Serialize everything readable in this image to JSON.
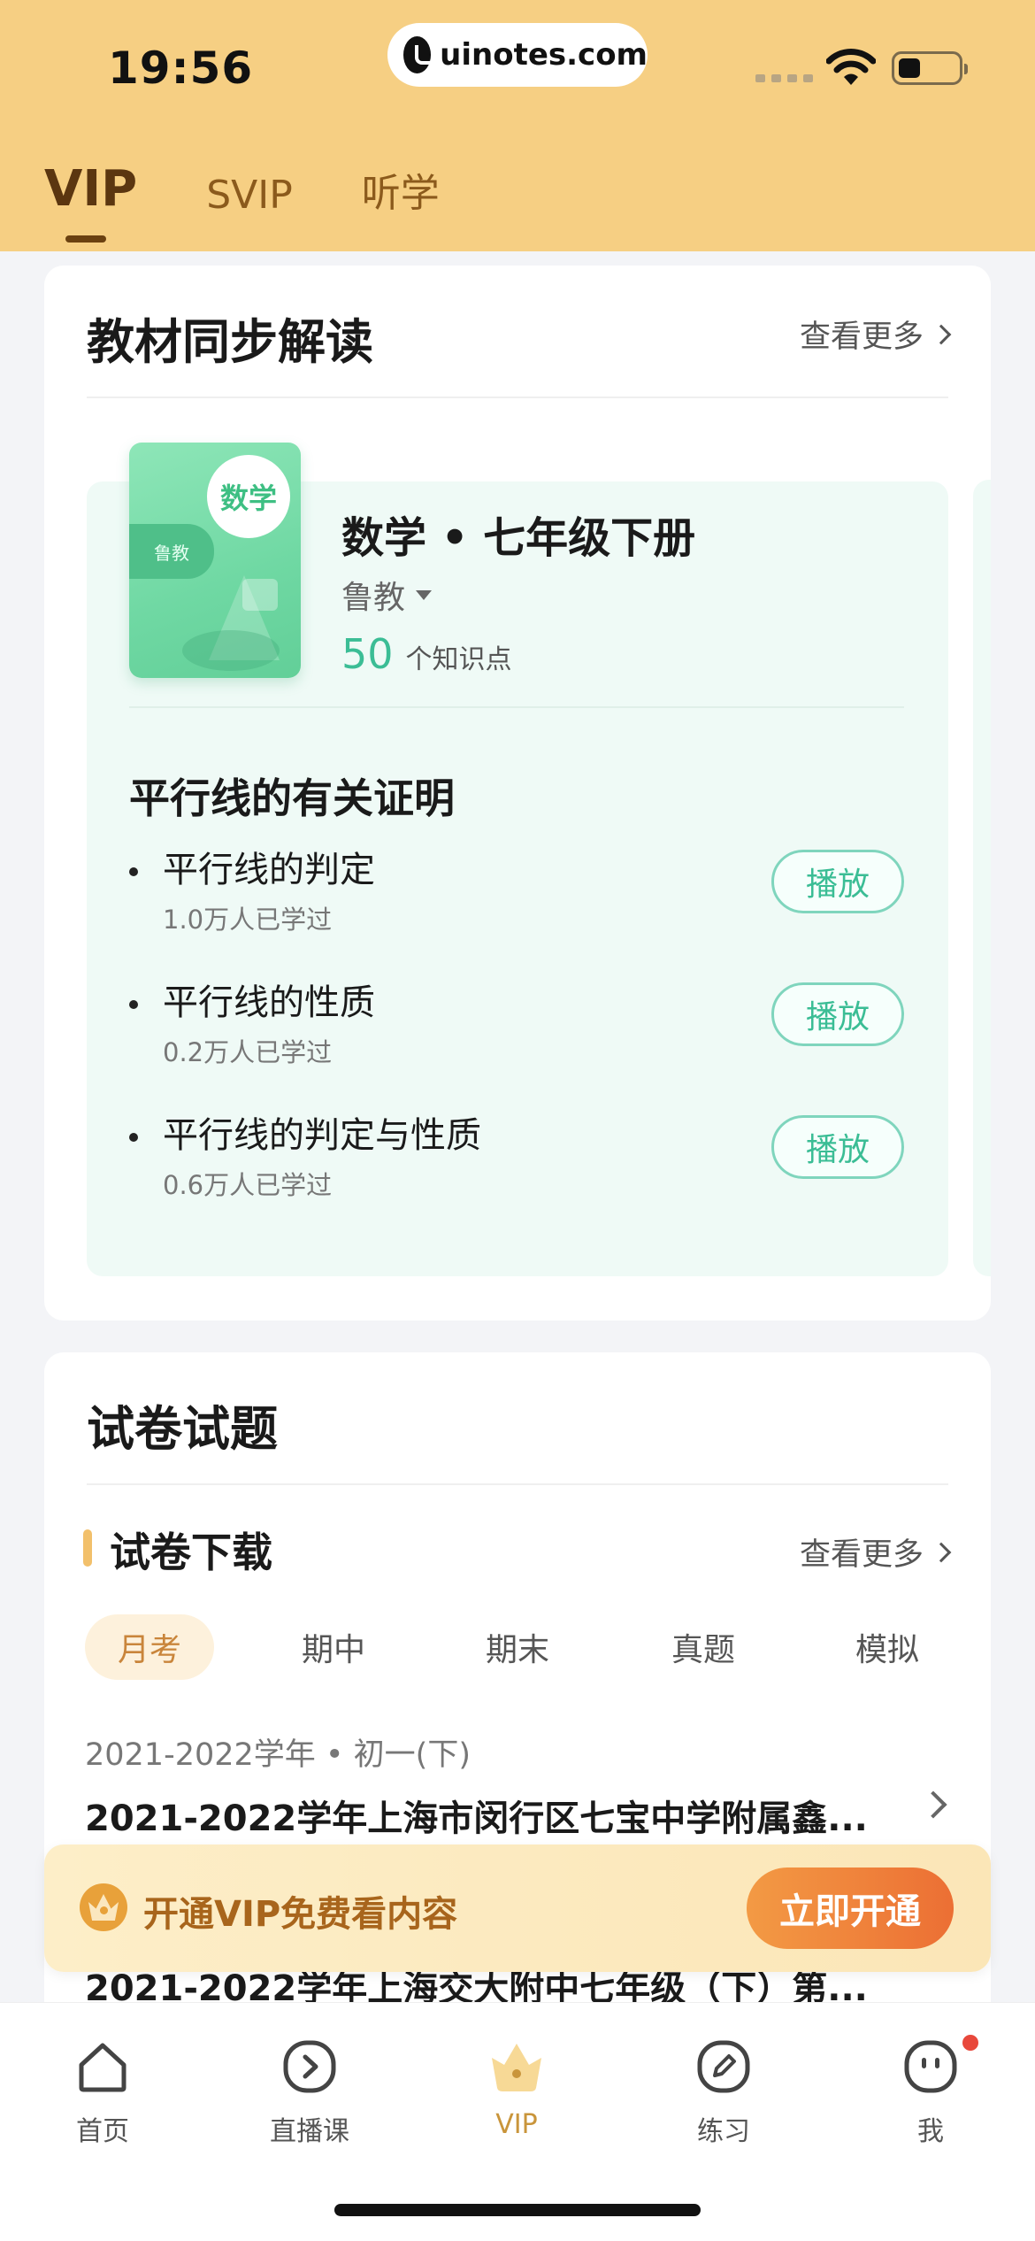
{
  "status": {
    "time": "19:56",
    "url": "uinotes.com"
  },
  "tabs": [
    {
      "label": "VIP",
      "active": true
    },
    {
      "label": "SVIP",
      "active": false
    },
    {
      "label": "听学",
      "active": false
    }
  ],
  "textbook": {
    "section_title": "教材同步解读",
    "more_label": "查看更多",
    "cover": {
      "badge": "数学",
      "tag": "鲁教"
    },
    "book_title": "数学 • 七年级下册",
    "publisher": "鲁教",
    "knowledge_count": "50",
    "knowledge_label": "个知识点",
    "chapter": "平行线的有关证明",
    "lessons": [
      {
        "name": "平行线的判定",
        "count": "1.0万人已学过",
        "button": "播放"
      },
      {
        "name": "平行线的性质",
        "count": "0.2万人已学过",
        "button": "播放"
      },
      {
        "name": "平行线的判定与性质",
        "count": "0.6万人已学过",
        "button": "播放"
      }
    ]
  },
  "papers": {
    "card_title": "试卷试题",
    "section_title": "试卷下载",
    "more_label": "查看更多",
    "filters": [
      "月考",
      "期中",
      "期末",
      "真题",
      "模拟"
    ],
    "active_filter": "月考",
    "items": [
      {
        "year": "2021-2022学年 • 初一(下)",
        "title": "2021-2022学年上海市闵行区七宝中学附属鑫..."
      },
      {
        "title": "2021-2022学年上海交大附中七年级（下）第..."
      }
    ]
  },
  "vip_banner": {
    "text": "开通VIP免费看内容",
    "button": "立即开通"
  },
  "bottom_nav": [
    {
      "label": "首页",
      "icon": "home-icon"
    },
    {
      "label": "直播课",
      "icon": "live-play-icon"
    },
    {
      "label": "VIP",
      "icon": "vip-crown-icon",
      "active": true
    },
    {
      "label": "练习",
      "icon": "pencil-icon"
    },
    {
      "label": "我",
      "icon": "profile-face-icon",
      "badge": true
    }
  ],
  "colors": {
    "header": "#f6cf83",
    "accent_green": "#3bbd95",
    "accent_orange": "#ec6f34"
  }
}
